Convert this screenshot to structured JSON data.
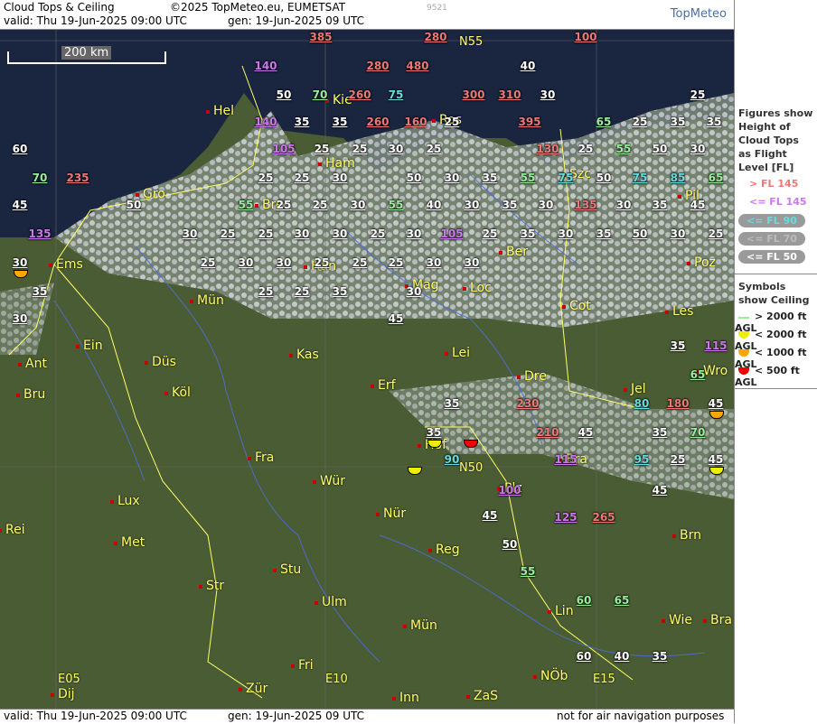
{
  "header": {
    "title": "Cloud Tops & Ceiling",
    "copyright": "©2025 TopMeteo.eu, EUMETSAT",
    "code": "9521",
    "valid": "valid:  Thu  19-Jun-2025  09:00 UTC",
    "gen": "gen: 19-Jun-2025 09 UTC",
    "logo": "TopMeteo"
  },
  "footer": {
    "valid": "valid:  Thu  19-Jun-2025  09:00 UTC",
    "gen": "gen: 19-Jun-2025 09 UTC",
    "disclaimer": "not for air navigation purposes"
  },
  "map": {
    "scale": "200 km",
    "grid_labels": [
      "N55",
      "N50",
      "E05",
      "E10",
      "E15"
    ],
    "cities": [
      "Hel",
      "Kie",
      "Ros",
      "Szc",
      "Ham",
      "Gro",
      "Bre",
      "Pil",
      "Ems",
      "Han",
      "Ber",
      "Poz",
      "Mag",
      "Loc",
      "Mün",
      "Cot",
      "Les",
      "Ein",
      "Ant",
      "Düs",
      "Kas",
      "Lei",
      "Bru",
      "Köl",
      "Erf",
      "Dre",
      "Jel",
      "Wro",
      "Hof",
      "Fra",
      "Bra",
      "Lux",
      "Wür",
      "Plz",
      "Rei",
      "Nür",
      "Met",
      "Reg",
      "Brn",
      "Str",
      "Stu",
      "Ulm",
      "Lin",
      "Wie",
      "Bra",
      "Mün",
      "Fri",
      "Dij",
      "Zür",
      "Inn",
      "ZaS",
      "NÖb"
    ],
    "tops": [
      [
        "385",
        "#ee7777"
      ],
      [
        "280",
        "#ee7777"
      ],
      [
        "100",
        "#ee7777"
      ],
      [
        "40",
        "#ffffff"
      ],
      [
        "140",
        "#cc77ee"
      ],
      [
        "280",
        "#ee7777"
      ],
      [
        "480",
        "#ee7777"
      ],
      [
        "50",
        "#ffffff"
      ],
      [
        "70",
        "#99ee99"
      ],
      [
        "260",
        "#ee7777"
      ],
      [
        "75",
        "#66dddd"
      ],
      [
        "300",
        "#ee7777"
      ],
      [
        "310",
        "#ee7777"
      ],
      [
        "30",
        "#ffffff"
      ],
      [
        "25",
        "#ffffff"
      ],
      [
        "140",
        "#cc77ee"
      ],
      [
        "35",
        "#ffffff"
      ],
      [
        "35",
        "#ffffff"
      ],
      [
        "260",
        "#ee7777"
      ],
      [
        "160",
        "#ee7777"
      ],
      [
        "25",
        "#ffffff"
      ],
      [
        "395",
        "#ee7777"
      ],
      [
        "65",
        "#99ee99"
      ],
      [
        "25",
        "#ffffff"
      ],
      [
        "35",
        "#ffffff"
      ],
      [
        "35",
        "#ffffff"
      ],
      [
        "60",
        "#ffffff"
      ],
      [
        "105",
        "#cc77ee"
      ],
      [
        "25",
        "#ffffff"
      ],
      [
        "25",
        "#ffffff"
      ],
      [
        "30",
        "#ffffff"
      ],
      [
        "25",
        "#ffffff"
      ],
      [
        "130",
        "#ee7777"
      ],
      [
        "25",
        "#ffffff"
      ],
      [
        "55",
        "#99ee99"
      ],
      [
        "50",
        "#ffffff"
      ],
      [
        "30",
        "#ffffff"
      ],
      [
        "70",
        "#99ee99"
      ],
      [
        "235",
        "#ee7777"
      ],
      [
        "25",
        "#ffffff"
      ],
      [
        "25",
        "#ffffff"
      ],
      [
        "30",
        "#ffffff"
      ],
      [
        "50",
        "#ffffff"
      ],
      [
        "30",
        "#ffffff"
      ],
      [
        "35",
        "#ffffff"
      ],
      [
        "55",
        "#99ee99"
      ],
      [
        "75",
        "#66dddd"
      ],
      [
        "50",
        "#ffffff"
      ],
      [
        "75",
        "#66dddd"
      ],
      [
        "85",
        "#66dddd"
      ],
      [
        "65",
        "#99ee99"
      ],
      [
        "50",
        "#ffffff"
      ],
      [
        "55",
        "#99ee99"
      ],
      [
        "25",
        "#ffffff"
      ],
      [
        "25",
        "#ffffff"
      ],
      [
        "30",
        "#ffffff"
      ],
      [
        "55",
        "#99ee99"
      ],
      [
        "40",
        "#ffffff"
      ],
      [
        "30",
        "#ffffff"
      ],
      [
        "35",
        "#ffffff"
      ],
      [
        "30",
        "#ffffff"
      ],
      [
        "135",
        "#ee7777"
      ],
      [
        "30",
        "#ffffff"
      ],
      [
        "35",
        "#ffffff"
      ],
      [
        "45",
        "#ffffff"
      ],
      [
        "45",
        "#ffffff"
      ],
      [
        "135",
        "#cc77ee"
      ],
      [
        "30",
        "#ffffff"
      ],
      [
        "25",
        "#ffffff"
      ],
      [
        "25",
        "#ffffff"
      ],
      [
        "30",
        "#ffffff"
      ],
      [
        "30",
        "#ffffff"
      ],
      [
        "25",
        "#ffffff"
      ],
      [
        "30",
        "#ffffff"
      ],
      [
        "105",
        "#cc77ee"
      ],
      [
        "25",
        "#ffffff"
      ],
      [
        "35",
        "#ffffff"
      ],
      [
        "30",
        "#ffffff"
      ],
      [
        "35",
        "#ffffff"
      ],
      [
        "50",
        "#ffffff"
      ],
      [
        "30",
        "#ffffff"
      ],
      [
        "25",
        "#ffffff"
      ],
      [
        "30",
        "#ffffff"
      ],
      [
        "25",
        "#ffffff"
      ],
      [
        "30",
        "#ffffff"
      ],
      [
        "30",
        "#ffffff"
      ],
      [
        "25",
        "#ffffff"
      ],
      [
        "25",
        "#ffffff"
      ],
      [
        "25",
        "#ffffff"
      ],
      [
        "30",
        "#ffffff"
      ],
      [
        "30",
        "#ffffff"
      ],
      [
        "35",
        "#ffffff"
      ],
      [
        "25",
        "#ffffff"
      ],
      [
        "25",
        "#ffffff"
      ],
      [
        "35",
        "#ffffff"
      ],
      [
        "30",
        "#ffffff"
      ],
      [
        "45",
        "#ffffff"
      ],
      [
        "30",
        "#ffffff"
      ],
      [
        "35",
        "#ffffff"
      ],
      [
        "115",
        "#cc77ee"
      ],
      [
        "65",
        "#99ee99"
      ],
      [
        "80",
        "#66dddd"
      ],
      [
        "180",
        "#ee7777"
      ],
      [
        "45",
        "#ffffff"
      ],
      [
        "230",
        "#ee7777"
      ],
      [
        "35",
        "#ffffff"
      ],
      [
        "35",
        "#ffffff"
      ],
      [
        "210",
        "#ee7777"
      ],
      [
        "45",
        "#ffffff"
      ],
      [
        "70",
        "#99ee99"
      ],
      [
        "35",
        "#ffffff"
      ],
      [
        "90",
        "#66dddd"
      ],
      [
        "115",
        "#cc77ee"
      ],
      [
        "95",
        "#66dddd"
      ],
      [
        "25",
        "#ffffff"
      ],
      [
        "45",
        "#ffffff"
      ],
      [
        "100",
        "#cc77ee"
      ],
      [
        "45",
        "#ffffff"
      ],
      [
        "45",
        "#ffffff"
      ],
      [
        "125",
        "#cc77ee"
      ],
      [
        "265",
        "#ee7777"
      ],
      [
        "50",
        "#ffffff"
      ],
      [
        "55",
        "#99ee99"
      ],
      [
        "60",
        "#99ee99"
      ],
      [
        "65",
        "#99ee99"
      ],
      [
        "60",
        "#ffffff"
      ],
      [
        "40",
        "#ffffff"
      ],
      [
        "35",
        "#ffffff"
      ]
    ]
  },
  "legend": {
    "title1": "Figures show Height of Cloud Tops as Flight Level  [FL]",
    "items": [
      [
        "> FL 145",
        "#ee7777"
      ],
      [
        "<= FL 145",
        "#cc77ee"
      ],
      [
        "<= FL 90",
        "#66dddd"
      ],
      [
        "<= FL 70",
        "#bbbbbb"
      ],
      [
        "<= FL 50",
        "#ffffff"
      ]
    ],
    "title2": "Symbols show Ceiling",
    "symbols": [
      [
        "> 2000 ft AGL",
        "#99ee99"
      ],
      [
        "< 2000 ft AGL",
        "#eeee00"
      ],
      [
        "< 1000 ft AGL",
        "#ffa500"
      ],
      [
        "< 500 ft AGL",
        "#ee0000"
      ]
    ]
  }
}
